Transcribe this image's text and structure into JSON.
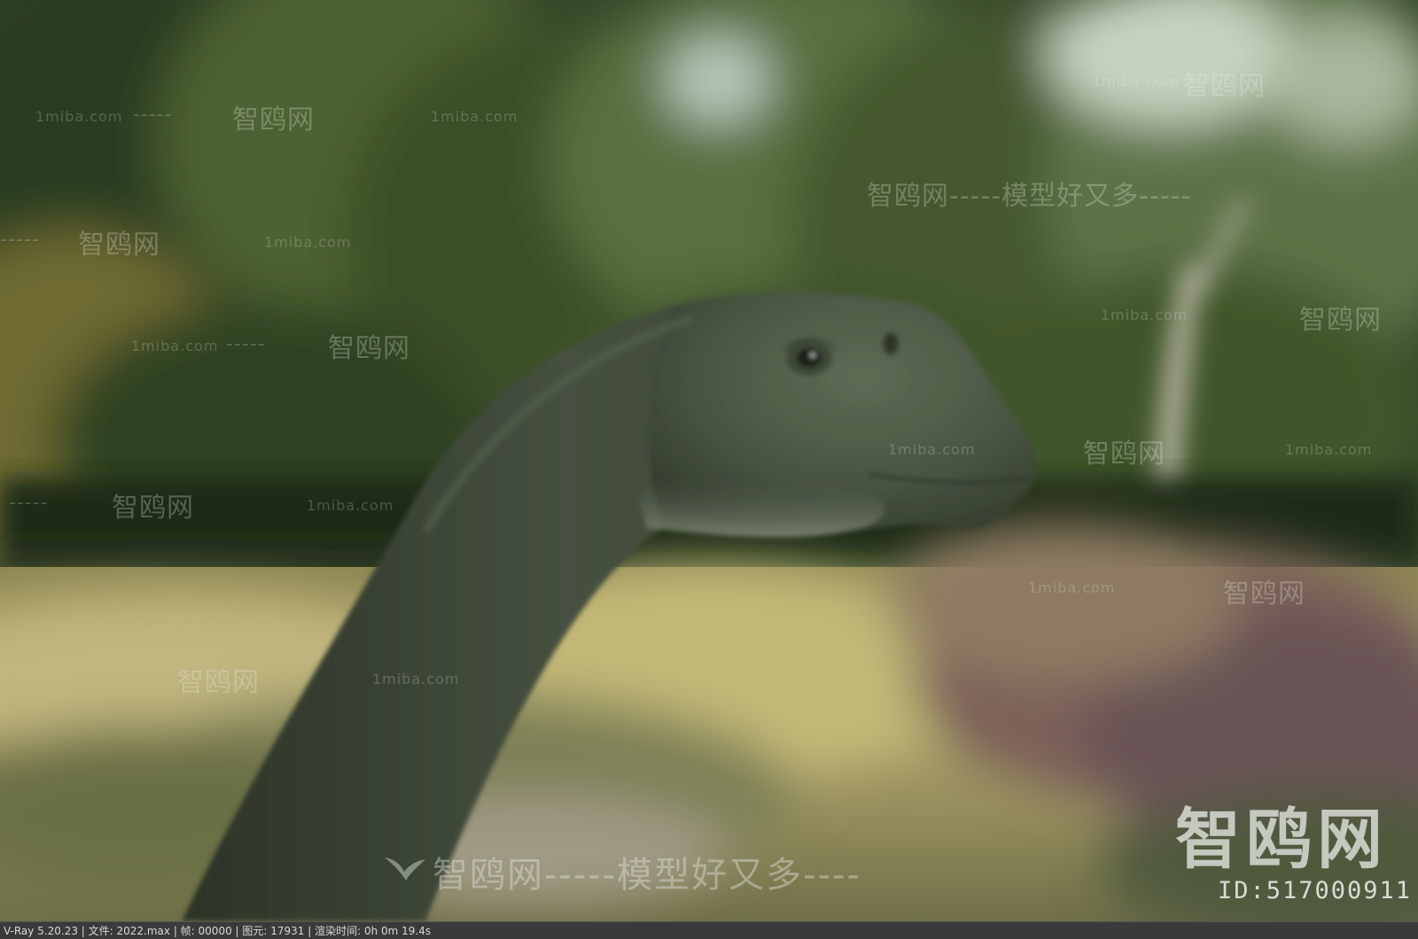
{
  "watermarks": {
    "site_cn": "智鸥网",
    "site_en": "1miba.com",
    "dashes": "-----",
    "slogan": "智鸥网-----模型好又多-----",
    "slogan_bottom": "智鸥网-----模型好又多----",
    "brand_big": "智鸥网",
    "id_label": "ID:517000911"
  },
  "status_bar": {
    "text": "V-Ray 5.20.23 | 文件: 2022.max | 帧: 00000 | 图元: 17931 | 渲染时间: 0h  0m 19.4s"
  },
  "colors": {
    "foliage": "#3c4f2e",
    "meadow": "#a79c63",
    "dinosaur_skin": "#4f5a45",
    "status_bar_bg": "#3a3a3a"
  }
}
